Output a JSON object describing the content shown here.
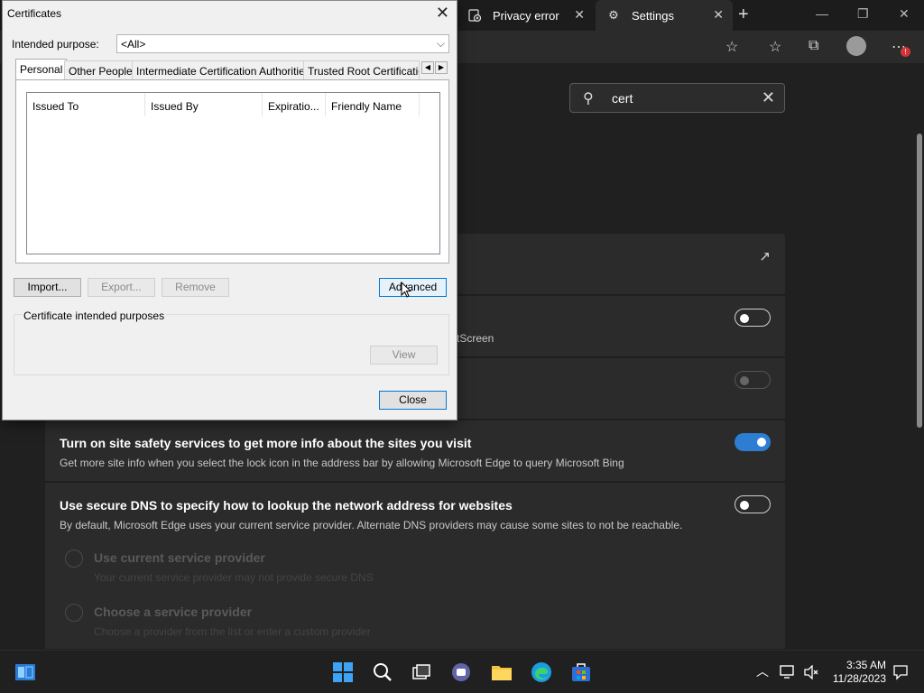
{
  "browser": {
    "tabs": [
      {
        "title": "Privacy error",
        "icon": "privacy-error-icon"
      },
      {
        "title": "Settings",
        "icon": "gear-icon"
      }
    ],
    "search_value": "cert"
  },
  "settings": {
    "partial_text": "tScreen",
    "site_safety_title": "Turn on site safety services to get more info about the sites you visit",
    "site_safety_desc": "Get more site info when you select the lock icon in the address bar by allowing Microsoft Edge to query Microsoft Bing",
    "secure_dns_title": "Use secure DNS to specify how to lookup the network address for websites",
    "secure_dns_desc": "By default, Microsoft Edge uses your current service provider. Alternate DNS providers may cause some sites to not be reachable.",
    "radio_current_title": "Use current service provider",
    "radio_current_desc": "Your current service provider may not provide secure DNS",
    "radio_choose_title": "Choose a service provider",
    "radio_choose_desc": "Choose a provider from the list or enter a custom provider"
  },
  "dialog": {
    "title": "Certificates",
    "purpose_label": "Intended purpose:",
    "purpose_value": "<All>",
    "tabs": [
      "Personal",
      "Other People",
      "Intermediate Certification Authorities",
      "Trusted Root Certification"
    ],
    "columns": [
      "Issued To",
      "Issued By",
      "Expiratio...",
      "Friendly Name"
    ],
    "buttons": {
      "import": "Import...",
      "export": "Export...",
      "remove": "Remove",
      "advanced": "Advanced",
      "view": "View",
      "close": "Close"
    },
    "group_label": "Certificate intended purposes"
  },
  "taskbar": {
    "time": "3:35 AM",
    "date": "11/28/2023"
  },
  "colors": {
    "accent": "#0078d7",
    "toggle_on": "#2d7dd2",
    "dark_bg": "#202020"
  }
}
